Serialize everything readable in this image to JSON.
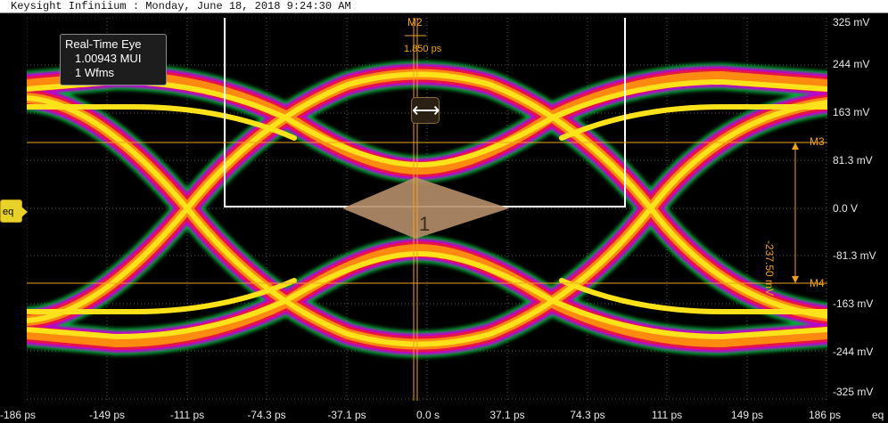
{
  "title_bar": {
    "text": "Keysight Infiniium : Monday, June 18, 2018 9:24:30 AM"
  },
  "info_box": {
    "mode": "Real-Time Eye",
    "ui_count": "1.00943 MUI",
    "waveforms": "1 Wfms"
  },
  "channel_marker": {
    "label": "eq"
  },
  "y_axis": {
    "labels": [
      "325 mV",
      "244 mV",
      "163 mV",
      "81.3 mV",
      "0.0 V",
      "-81.3 mV",
      "-163 mV",
      "-244 mV",
      "-325 mV"
    ]
  },
  "x_axis": {
    "labels": [
      "-186 ps",
      "-149 ps",
      "-111 ps",
      "-74.3 ps",
      "-37.1 ps",
      "0.0 s",
      "37.1 ps",
      "74.3 ps",
      "111 ps",
      "149 ps",
      "186 ps"
    ],
    "source_label": "eq"
  },
  "markers": {
    "m2": {
      "name": "M2",
      "delta": "1.850 ps"
    },
    "m3": {
      "name": "M3"
    },
    "m4": {
      "name": "M4"
    },
    "delta_y": "-237.50 mV"
  },
  "mask": {
    "number": "1"
  },
  "drag_handle": {
    "glyph": "⟷"
  },
  "colors": {
    "marker": "#f0a020",
    "grid": "#5a5a5a",
    "mask": "#b58e6a",
    "eye_core": "#ffe21a",
    "eye_mid": "#ff8a10",
    "eye_edge": "#e8124a",
    "eye_outer": "#c000d0",
    "eye_fringe": "#00c040"
  }
}
